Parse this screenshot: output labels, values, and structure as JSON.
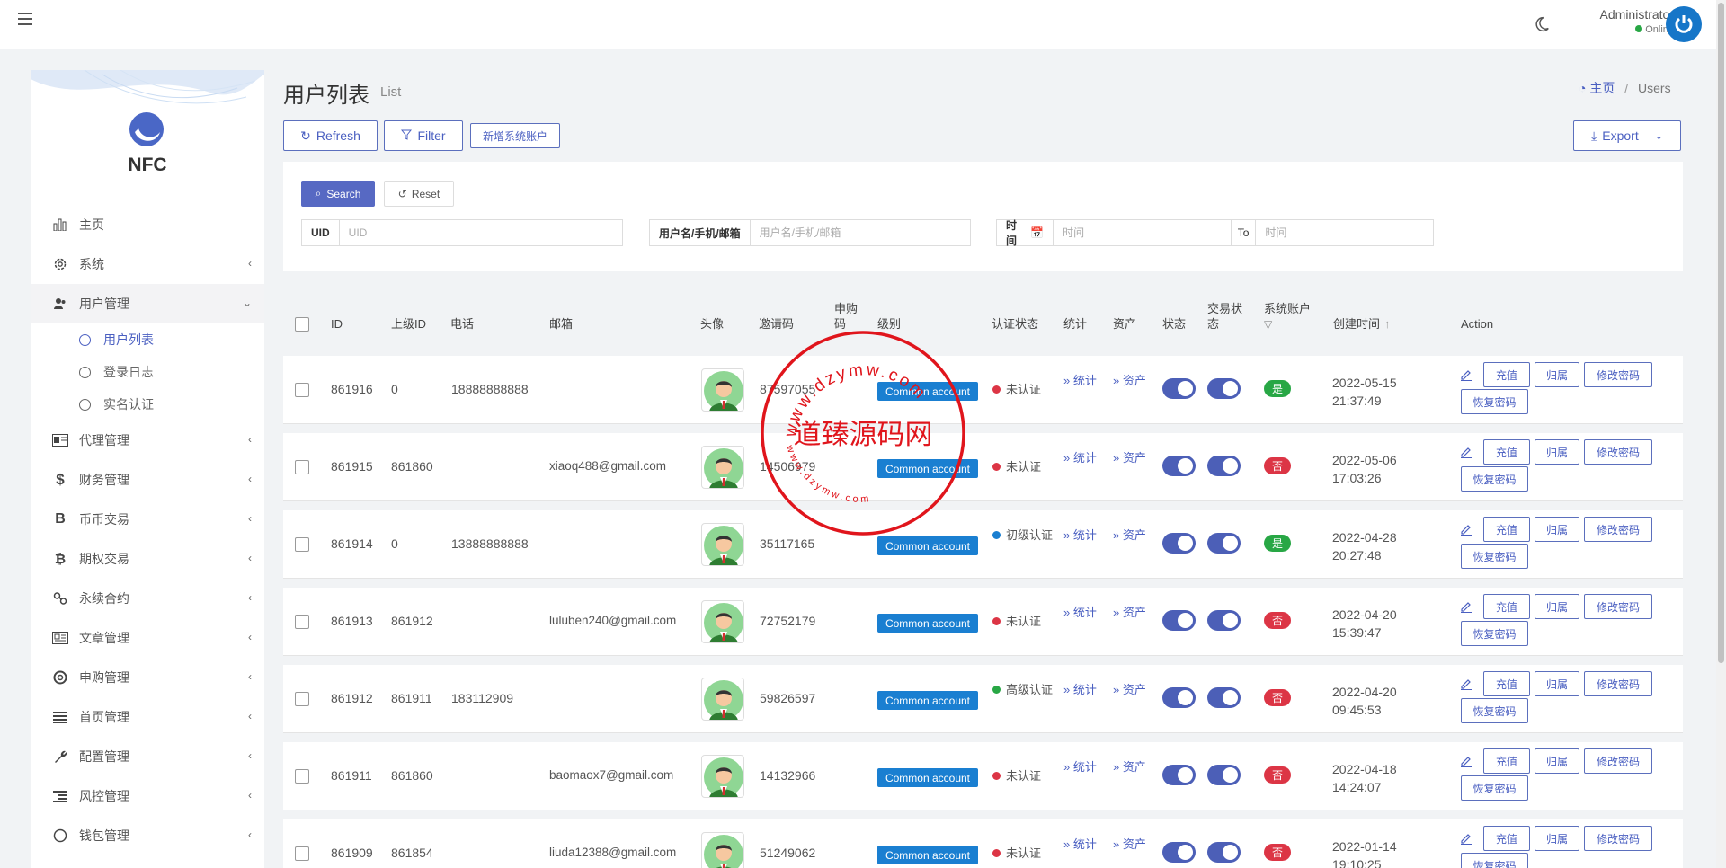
{
  "topbar": {
    "user_name": "Administrator",
    "user_status": "Online"
  },
  "sidebar": {
    "brand": "NFC",
    "items": [
      {
        "label": "主页",
        "icon": "bar-chart-icon"
      },
      {
        "label": "系统",
        "icon": "gear-icon"
      },
      {
        "label": "用户管理",
        "icon": "users-icon"
      },
      {
        "label": "代理管理",
        "icon": "id-card-icon"
      },
      {
        "label": "财务管理",
        "icon": "dollar-icon"
      },
      {
        "label": "币币交易",
        "icon": "letter-b-icon"
      },
      {
        "label": "期权交易",
        "icon": "bitcoin-icon"
      },
      {
        "label": "永续合约",
        "icon": "link-icon"
      },
      {
        "label": "文章管理",
        "icon": "newspaper-icon"
      },
      {
        "label": "申购管理",
        "icon": "lifebuoy-icon"
      },
      {
        "label": "首页管理",
        "icon": "list-icon"
      },
      {
        "label": "配置管理",
        "icon": "wrench-icon"
      },
      {
        "label": "风控管理",
        "icon": "list-indent-icon"
      },
      {
        "label": "钱包管理",
        "icon": "circle-icon"
      }
    ],
    "sub_items": [
      {
        "label": "用户列表"
      },
      {
        "label": "登录日志"
      },
      {
        "label": "实名认证"
      }
    ]
  },
  "page": {
    "title": "用户列表",
    "subtitle": "List",
    "breadcrumb_home": "主页",
    "breadcrumb_sep": "/",
    "breadcrumb_current": "Users"
  },
  "toolbar": {
    "refresh": "Refresh",
    "filter": "Filter",
    "add_system_account": "新增系统账户",
    "export": "Export"
  },
  "search": {
    "search_btn": "Search",
    "reset_btn": "Reset",
    "uid_label": "UID",
    "uid_placeholder": "UID",
    "user_label": "用户名/手机/邮箱",
    "user_placeholder": "用户名/手机/邮箱",
    "time_label": "时间",
    "time_placeholder": "时间",
    "to_label": "To",
    "to_placeholder": "时间"
  },
  "table": {
    "headers": {
      "id": "ID",
      "parent_id": "上级ID",
      "phone": "电话",
      "email": "邮箱",
      "avatar": "头像",
      "invite_code": "邀请码",
      "purchase_code": "申购码",
      "level": "级别",
      "auth_status": "认证状态",
      "stats": "统计",
      "assets": "资产",
      "status": "状态",
      "trade_status": "交易状态",
      "system_account": "系统账户",
      "created_at": "创建时间",
      "action": "Action"
    },
    "rows": [
      {
        "id": "861916",
        "parent": "0",
        "phone": "18888888888",
        "email": "",
        "invite": "87597055",
        "level": "Common account",
        "auth": "未认证",
        "auth_color": "#dc3545",
        "stats": "» 统计",
        "assets": "» 资产",
        "sys": "是",
        "sys_yes": true,
        "date": "2022-05-15",
        "time": "21:37:49"
      },
      {
        "id": "861915",
        "parent": "861860",
        "phone": "",
        "email": "xiaoq488@gmail.com",
        "invite": "14506979",
        "level": "Common account",
        "auth": "未认证",
        "auth_color": "#dc3545",
        "stats": "» 统计",
        "assets": "» 资产",
        "sys": "否",
        "sys_yes": false,
        "date": "2022-05-06",
        "time": "17:03:26"
      },
      {
        "id": "861914",
        "parent": "0",
        "phone": "13888888888",
        "email": "",
        "invite": "35117165",
        "level": "Common account",
        "auth": "初级认证",
        "auth_color": "#1a7fd1",
        "stats": "» 统计",
        "assets": "» 资产",
        "sys": "是",
        "sys_yes": true,
        "date": "2022-04-28",
        "time": "20:27:48"
      },
      {
        "id": "861913",
        "parent": "861912",
        "phone": "",
        "email": "luluben240@gmail.com",
        "invite": "72752179",
        "level": "Common account",
        "auth": "未认证",
        "auth_color": "#dc3545",
        "stats": "» 统计",
        "assets": "» 资产",
        "sys": "否",
        "sys_yes": false,
        "date": "2022-04-20",
        "time": "15:39:47"
      },
      {
        "id": "861912",
        "parent": "861911",
        "phone": "183112909",
        "email": "",
        "invite": "59826597",
        "level": "Common account",
        "auth": "高级认证",
        "auth_color": "#28a745",
        "stats": "» 统计",
        "assets": "» 资产",
        "sys": "否",
        "sys_yes": false,
        "date": "2022-04-20",
        "time": "09:45:53"
      },
      {
        "id": "861911",
        "parent": "861860",
        "phone": "",
        "email": "baomaox7@gmail.com",
        "invite": "14132966",
        "level": "Common account",
        "auth": "未认证",
        "auth_color": "#dc3545",
        "stats": "» 统计",
        "assets": "» 资产",
        "sys": "否",
        "sys_yes": false,
        "date": "2022-04-18",
        "time": "14:24:07"
      },
      {
        "id": "861909",
        "parent": "861854",
        "phone": "",
        "email": "liuda12388@gmail.com",
        "invite": "51249062",
        "level": "Common account",
        "auth": "未认证",
        "auth_color": "#dc3545",
        "stats": "» 统计",
        "assets": "» 资产",
        "sys": "否",
        "sys_yes": false,
        "date": "2022-01-14",
        "time": "19:10:25"
      }
    ],
    "actions": {
      "recharge": "充值",
      "assign": "归属",
      "change_password": "修改密码",
      "restore_password": "恢复密码"
    }
  },
  "watermark": {
    "center_text": "道臻源码网",
    "ring_text": "www.dzymw.com"
  },
  "colors": {
    "accent": "#4a5fc1",
    "badge_blue": "#1a7fd1",
    "yes_green": "#28a745",
    "no_red": "#dc3545",
    "stamp_red": "#e0151c"
  }
}
